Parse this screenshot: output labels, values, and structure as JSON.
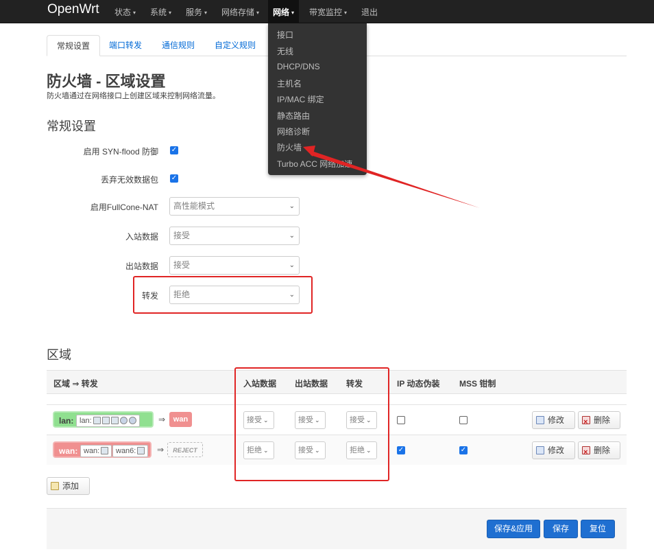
{
  "navbar": {
    "brand": "OpenWrt",
    "items": [
      {
        "label": "状态",
        "caret": "▾"
      },
      {
        "label": "系统",
        "caret": "▾"
      },
      {
        "label": "服务",
        "caret": "▾"
      },
      {
        "label": "网络存储",
        "caret": "▾"
      },
      {
        "label": "网络",
        "caret": "▾"
      },
      {
        "label": "带宽监控",
        "caret": "▾"
      },
      {
        "label": "退出",
        "caret": ""
      }
    ]
  },
  "dropdown": {
    "items": [
      "接口",
      "无线",
      "DHCP/DNS",
      "主机名",
      "IP/MAC 绑定",
      "静态路由",
      "网络诊断",
      "防火墙",
      "Turbo ACC 网络加速"
    ]
  },
  "tabs": [
    "常规设置",
    "端口转发",
    "通信规则",
    "自定义规则"
  ],
  "page": {
    "title": "防火墙 - 区域设置",
    "description": "防火墙通过在网络接口上创建区域来控制网络流量。"
  },
  "general": {
    "title": "常规设置",
    "syn_flood_label": "启用 SYN-flood 防御",
    "drop_invalid_label": "丢弃无效数据包",
    "fullcone_label": "启用FullCone-NAT",
    "fullcone_value": "高性能模式",
    "input_label": "入站数据",
    "input_value": "接受",
    "output_label": "出站数据",
    "output_value": "接受",
    "forward_label": "转发",
    "forward_value": "拒绝",
    "checkmark": "✓",
    "chevron": "⌄"
  },
  "zones": {
    "title": "区域",
    "headers": [
      "区域 ⇒ 转发",
      "入站数据",
      "出站数据",
      "转发",
      "IP 动态伪装",
      "MSS 钳制"
    ],
    "rows": [
      {
        "zone": "lan:",
        "ifaces": [
          "lan:"
        ],
        "arrow": "⇒",
        "dest": "wan",
        "input": "接受",
        "output": "接受",
        "forward": "接受",
        "masq": false,
        "mss": false,
        "color": "#90e090"
      },
      {
        "zone": "wan:",
        "ifaces": [
          "wan:",
          "wan6:"
        ],
        "arrow": "⇒",
        "dest": "REJECT",
        "input": "拒绝",
        "output": "接受",
        "forward": "拒绝",
        "masq": true,
        "mss": true,
        "color": "#f09090"
      }
    ],
    "edit_label": "修改",
    "delete_label": "删除",
    "add_label": "添加"
  },
  "footer": {
    "save_apply": "保存&应用",
    "save": "保存",
    "reset": "复位"
  },
  "colors": {
    "annotation_red": "#e02424",
    "primary": "#1f6fd1",
    "link": "#0069d6"
  }
}
